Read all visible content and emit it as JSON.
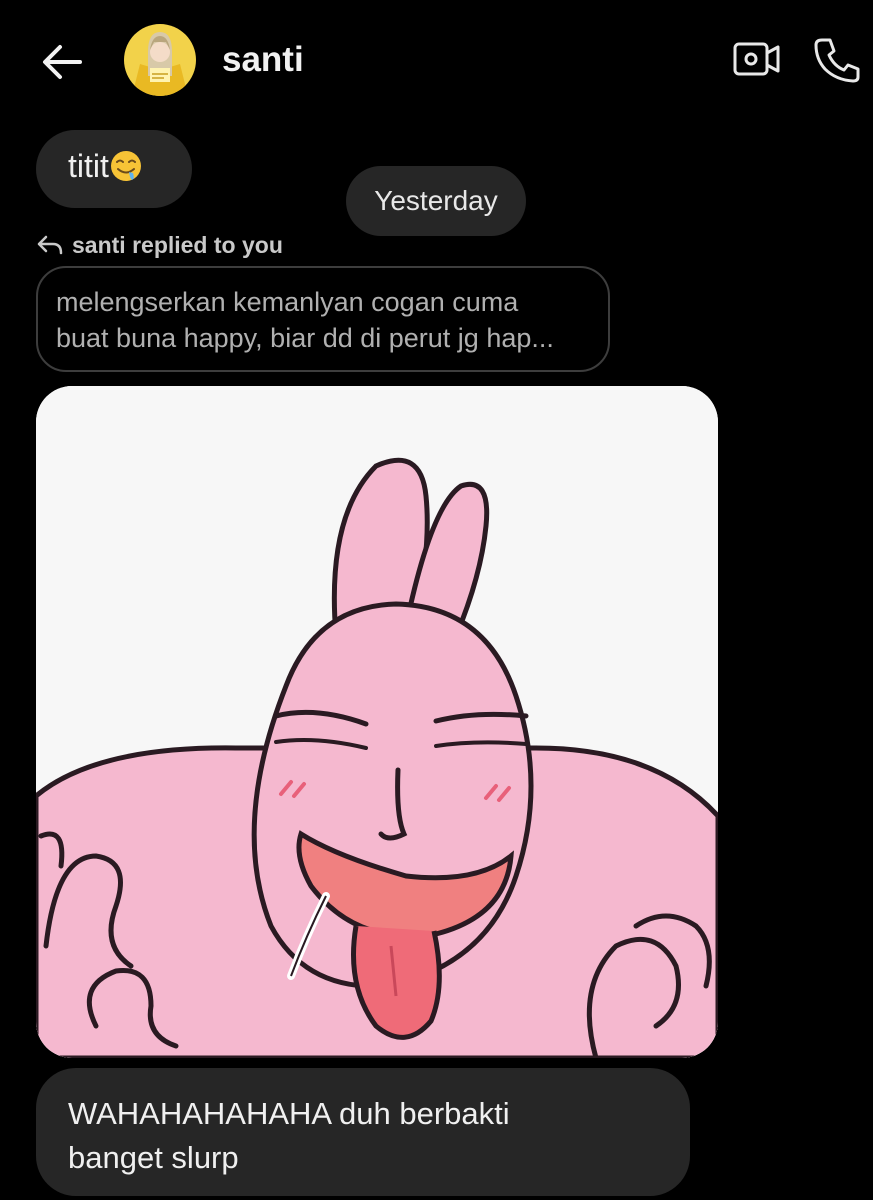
{
  "header": {
    "contact_name": "santi",
    "back_icon": "arrow-left-icon",
    "video_icon": "video-camera-icon",
    "call_icon": "phone-icon"
  },
  "messages": {
    "first": {
      "text": "titit",
      "emoji": "drooling-face-emoji"
    },
    "date_separator": "Yesterday",
    "reply_label": "santi replied to you",
    "quoted_lines": [
      "melengserkan kemanlyan cogan cuma",
      "buat buna happy, biar dd di perut jg hap..."
    ],
    "sticker": "pink-bunny-licking-sticker",
    "last_lines": [
      "WAHAHAHAHAHA duh berbakti",
      "banget slurp"
    ]
  },
  "colors": {
    "background": "#000000",
    "bubble": "#262626",
    "sticker_pink": "#f5b8cf"
  }
}
